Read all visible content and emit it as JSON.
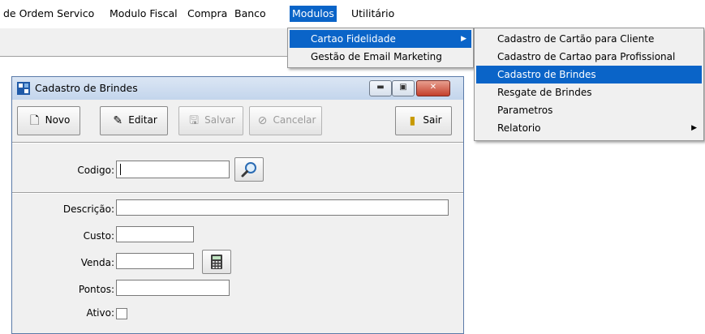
{
  "menubar": {
    "items": [
      "de Ordem Servico",
      "Modulo Fiscal",
      "Compra",
      "Banco",
      "Modulos",
      "Utilitário"
    ]
  },
  "modulos_menu": {
    "items": [
      "Cartao Fidelidade",
      "Gestão de Email Marketing"
    ]
  },
  "fidelidade_submenu": {
    "items": [
      "Cadastro de Cartão para Cliente",
      "Cadastro de Cartao para Profissional",
      "Cadastro de Brindes",
      "Resgate de Brindes",
      "Parametros",
      "Relatorio"
    ]
  },
  "window": {
    "title": "Cadastro de Brindes",
    "toolbar": {
      "novo": "Novo",
      "editar": "Editar",
      "salvar": "Salvar",
      "cancelar": "Cancelar",
      "sair": "Sair"
    }
  },
  "form": {
    "codigo_label": "Codigo:",
    "codigo_value": "",
    "descricao_label": "Descrição:",
    "descricao_value": "",
    "custo_label": "Custo:",
    "custo_value": "",
    "venda_label": "Venda:",
    "venda_value": "",
    "pontos_label": "Pontos:",
    "pontos_value": "",
    "ativo_label": "Ativo:",
    "ativo_checked": false
  },
  "colors": {
    "highlight": "#0a64c8",
    "window_border": "#5a7aa8"
  }
}
